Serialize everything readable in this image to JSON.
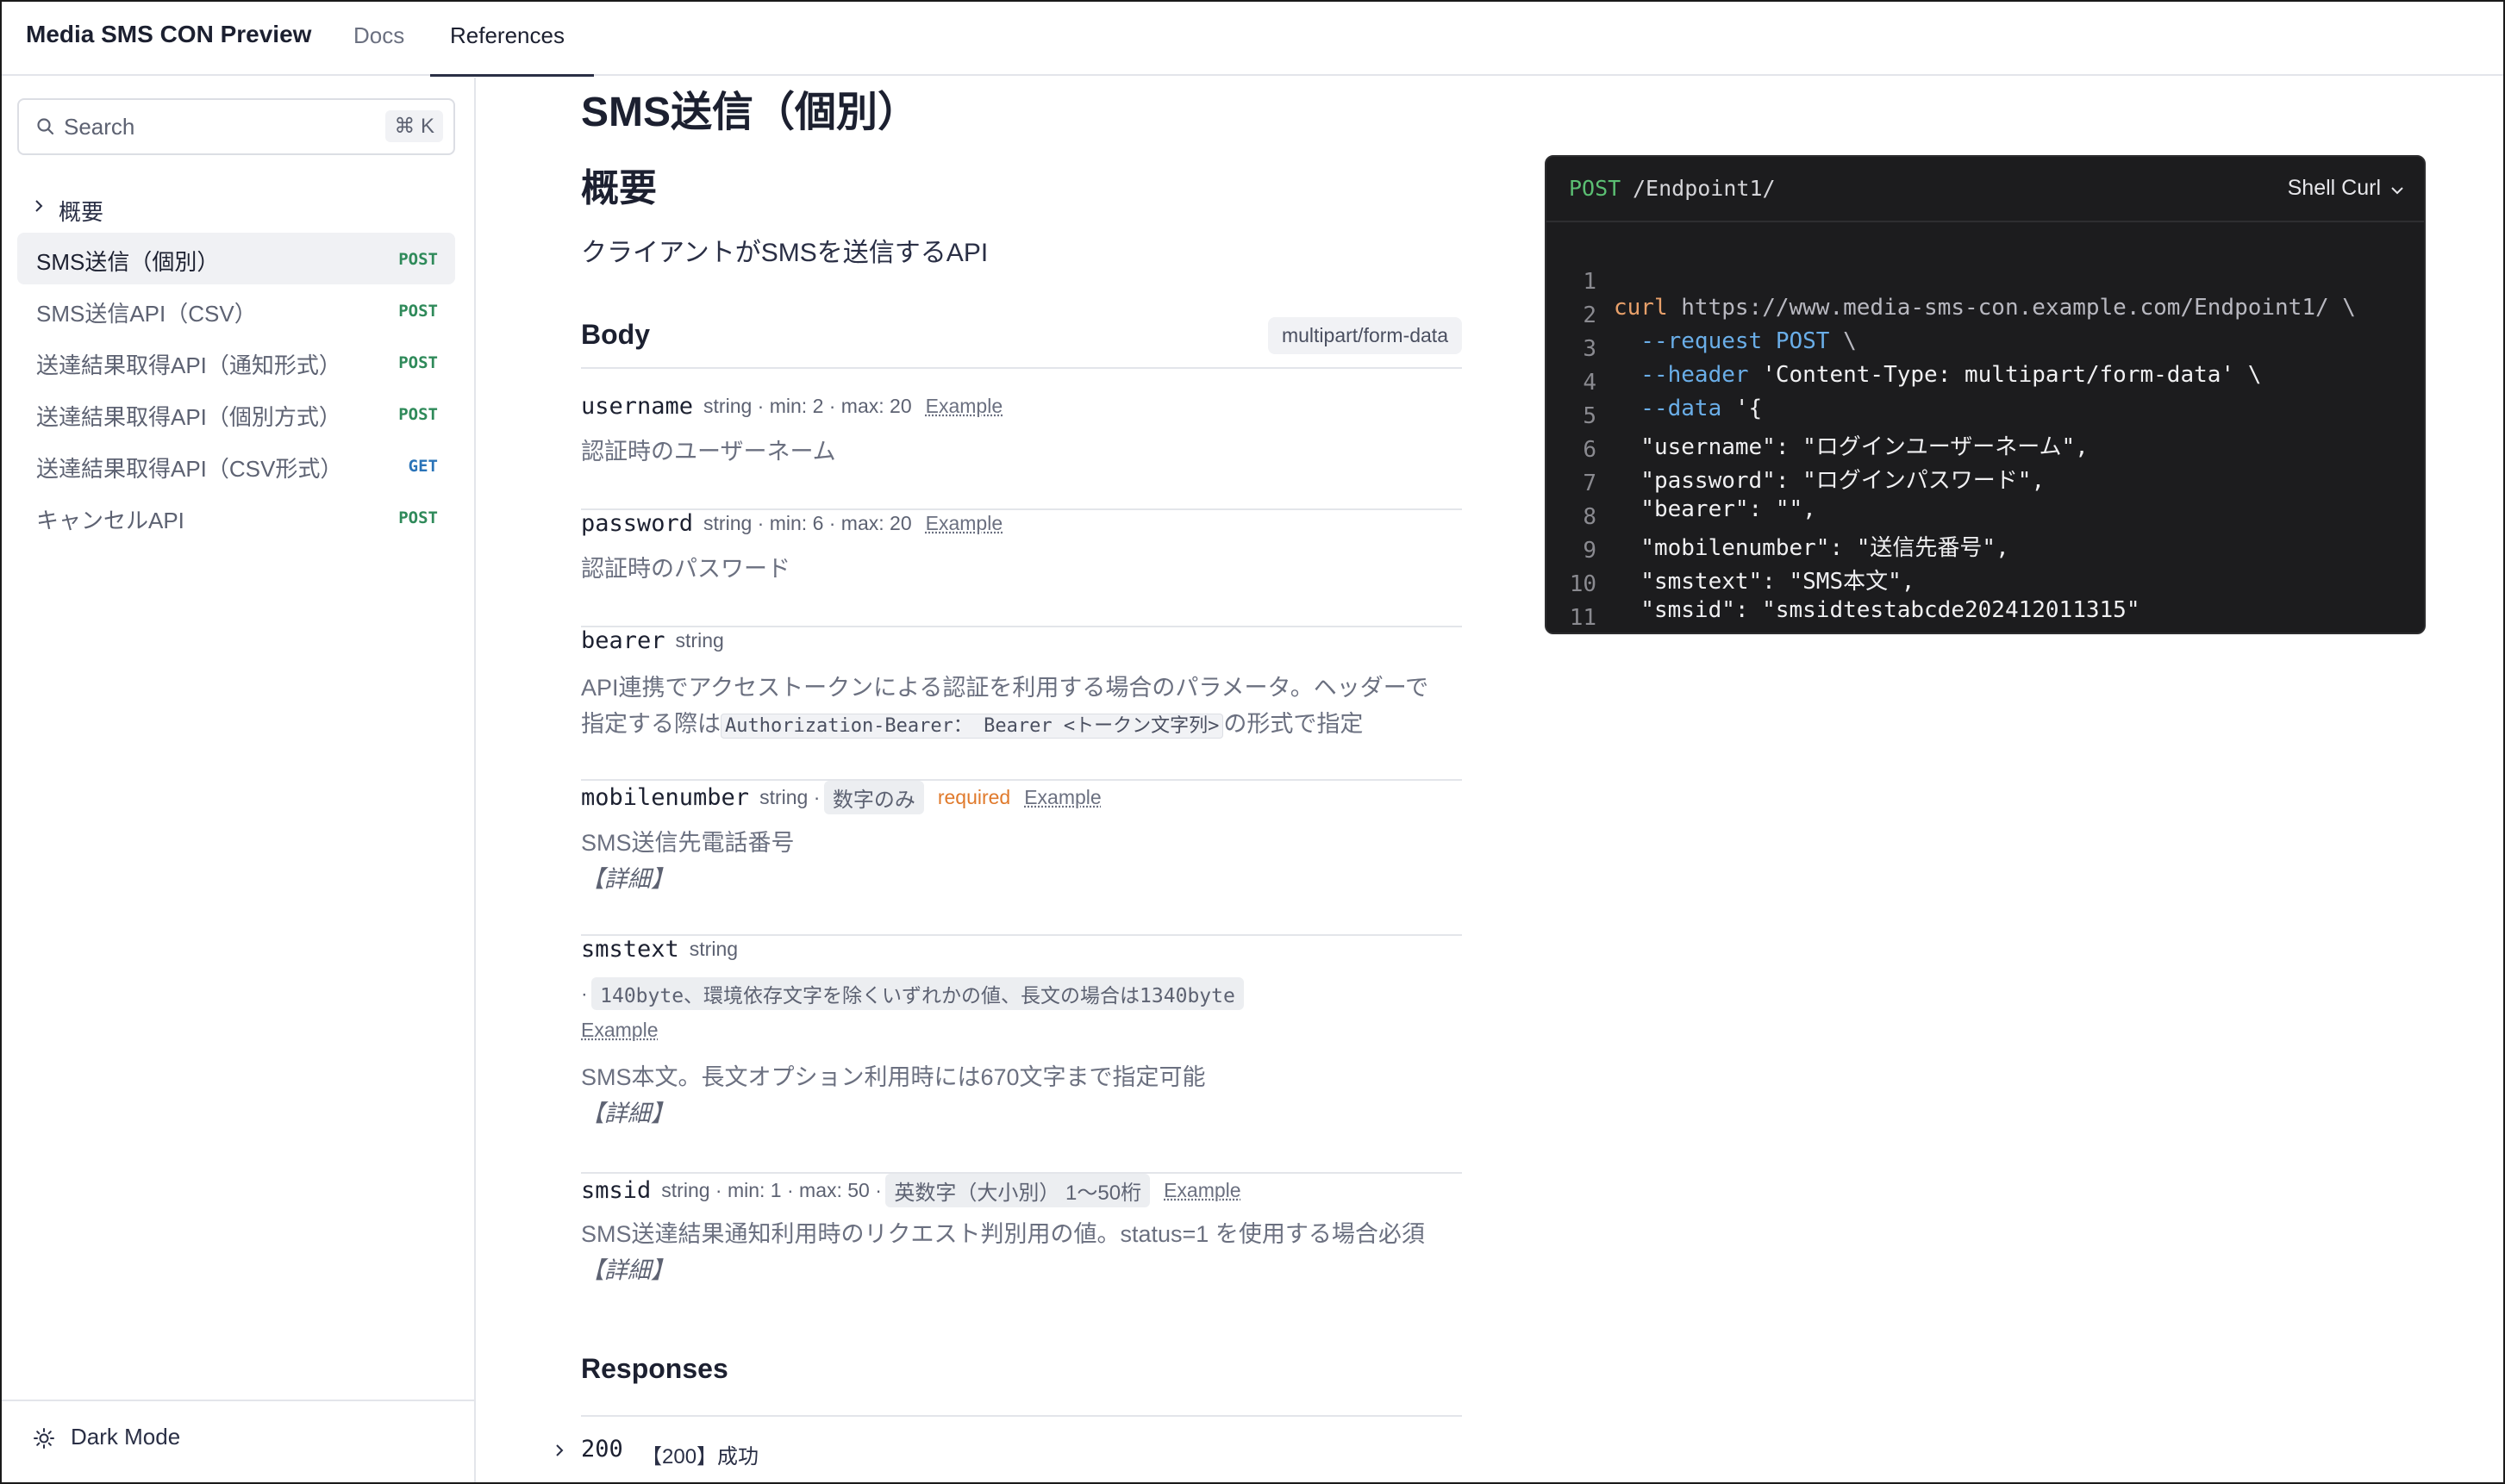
{
  "app": {
    "brand": "Media SMS CON Preview",
    "tabs": [
      {
        "label": "Docs"
      },
      {
        "label": "References"
      }
    ]
  },
  "sidebar": {
    "search_placeholder": "Search",
    "search_shortcut": "⌘ K",
    "group_label": "概要",
    "items": [
      {
        "label": "SMS送信（個別）",
        "method": "POST"
      },
      {
        "label": "SMS送信API（CSV）",
        "method": "POST"
      },
      {
        "label": "送達結果取得API（通知形式）",
        "method": "POST"
      },
      {
        "label": "送達結果取得API（個別方式）",
        "method": "POST"
      },
      {
        "label": "送達結果取得API（CSV形式）",
        "method": "GET"
      },
      {
        "label": "キャンセルAPI",
        "method": "POST"
      }
    ],
    "dark_mode_label": "Dark Mode"
  },
  "main": {
    "title": "SMS送信（個別）",
    "overview_heading": "概要",
    "overview_desc": "クライアントがSMSを送信するAPI",
    "body_heading": "Body",
    "content_type": "multipart/form-data",
    "params": {
      "username": {
        "name": "username",
        "meta": "string · min: 2 · max: 20",
        "example": "Example",
        "desc": "認証時のユーザーネーム"
      },
      "password": {
        "name": "password",
        "meta": "string · min: 6 · max: 20",
        "example": "Example",
        "desc": "認証時のパスワード"
      },
      "bearer": {
        "name": "bearer",
        "meta": "string",
        "desc_line1": "API連携でアクセストークンによる認証を利用する場合のパラメータ。ヘッダーで",
        "desc_line2_pre": "指定する際は",
        "desc_line2_code": "Authorization-Bearer： Bearer <トークン文字列>",
        "desc_line2_post": "の形式で指定"
      },
      "mobilenumber": {
        "name": "mobilenumber",
        "meta": "string ·",
        "pattern": "数字のみ",
        "required": "required",
        "example": "Example",
        "desc": "SMS送信先電話番号",
        "detail": "【詳細】"
      },
      "smstext": {
        "name": "smstext",
        "meta": "string",
        "pattern_prefix": "·",
        "pattern": "140byte、環境依存文字を除くいずれかの値、長文の場合は1340byte",
        "example": "Example",
        "desc": "SMS本文。長文オプション利用時には670文字まで指定可能",
        "detail": "【詳細】"
      },
      "smsid": {
        "name": "smsid",
        "meta": "string · min: 1 · max: 50 ·",
        "pattern": "英数字（大小別） 1〜50桁",
        "example": "Example",
        "desc": "SMS送達結果通知利用時のリクエスト判別用の値。status=1 を使用する場合必須",
        "detail": "【詳細】"
      }
    },
    "responses_heading": "Responses",
    "responses": [
      {
        "code": "200",
        "desc": "【200】成功"
      }
    ]
  },
  "code_sample": {
    "method": "POST",
    "path": "/Endpoint1/",
    "language": "Shell Curl",
    "lines": [
      {
        "num": "1",
        "cmd": "curl",
        "rest": " https://www.media-sms-con.example.com/Endpoint1/ \\"
      },
      {
        "num": "2",
        "flag": "  --request POST",
        "rest": " \\"
      },
      {
        "num": "3",
        "flag": "  --header",
        "rest": " 'Content-Type: multipart/form-data' \\"
      },
      {
        "num": "4",
        "flag": "  --data",
        "rest": " '{"
      },
      {
        "num": "5",
        "rest": "  \"username\": \"ログインユーザーネーム\","
      },
      {
        "num": "6",
        "rest": "  \"password\": \"ログインパスワード\","
      },
      {
        "num": "7",
        "rest": "  \"bearer\": \"\","
      },
      {
        "num": "8",
        "rest": "  \"mobilenumber\": \"送信先番号\","
      },
      {
        "num": "9",
        "rest": "  \"smstext\": \"SMS本文\","
      },
      {
        "num": "10",
        "rest": "  \"smsid\": \"smsidtestabcde202412011315\""
      },
      {
        "num": "11",
        "rest": "}'"
      }
    ]
  }
}
